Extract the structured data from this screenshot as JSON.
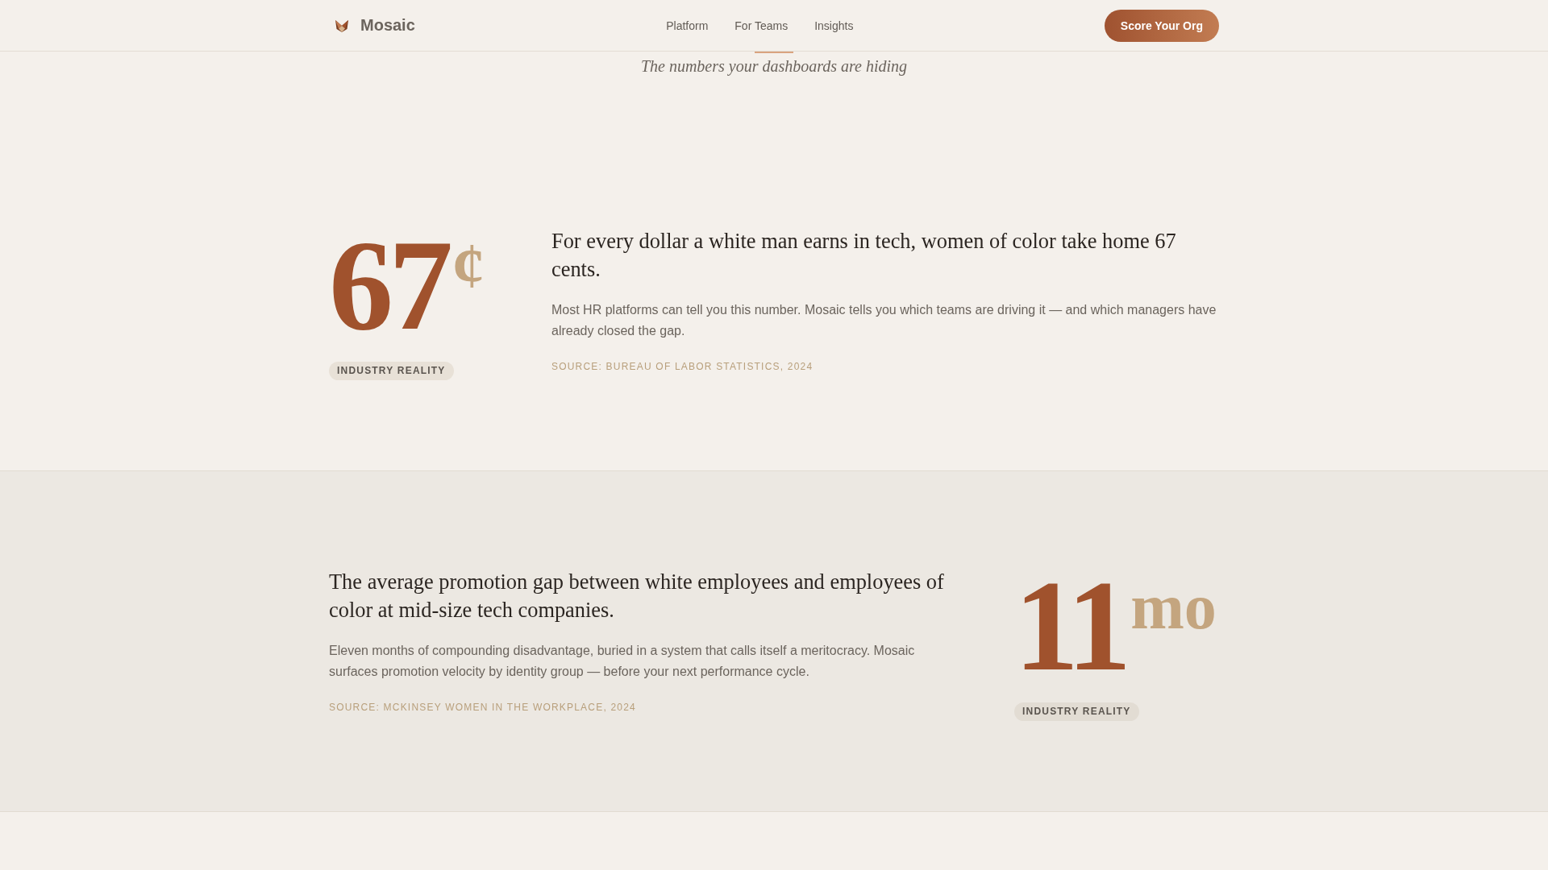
{
  "header": {
    "brand": "Mosaic",
    "nav": [
      "Platform",
      "For Teams",
      "Insights"
    ],
    "cta": "Score Your Org"
  },
  "intro": {
    "subtitle": "The numbers your dashboards are hiding"
  },
  "stats": [
    {
      "kind": "leading",
      "figure": "67",
      "unit": "¢",
      "badge": "INDUSTRY REALITY",
      "headline": "For every dollar a white man earns in tech, women of color take home 67 cents.",
      "body": "Most HR platforms can tell you this number. Mosaic tells you which teams are driving it — and which managers have already closed the gap.",
      "source": "SOURCE: BUREAU OF LABOR STATISTICS, 2024"
    },
    {
      "kind": "trailing",
      "figure": "11",
      "unit": "mo",
      "badge": "INDUSTRY REALITY",
      "headline": "The average promotion gap between white employees and employees of color at mid-size tech companies.",
      "body": "Eleven months of compounding disadvantage, buried in a system that calls itself a meritocracy. Mosaic surfaces promotion velocity by identity group — before your next performance cycle.",
      "source": "SOURCE: MCKINSEY WOMEN IN THE WORKPLACE, 2024"
    }
  ]
}
